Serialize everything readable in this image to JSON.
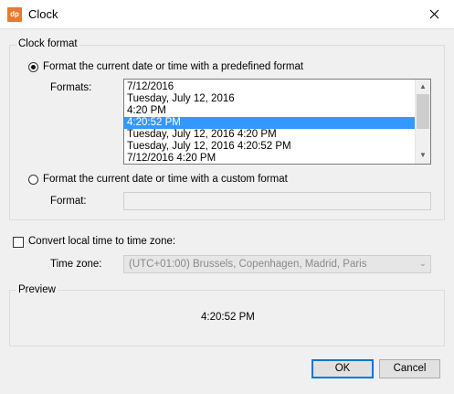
{
  "window": {
    "title": "Clock",
    "app_icon_text": "dp"
  },
  "clock_format": {
    "group_label": "Clock format",
    "predefined_radio_label": "Format the current date or time with a predefined format",
    "formats_label": "Formats:",
    "formats": [
      "7/12/2016",
      "Tuesday, July 12, 2016",
      "4:20 PM",
      "4:20:52 PM",
      "Tuesday, July 12, 2016 4:20 PM",
      "Tuesday, July 12, 2016 4:20:52 PM",
      "7/12/2016 4:20 PM"
    ],
    "selected_format": "4:20:52 PM",
    "custom_radio_label": "Format the current date or time with a custom format",
    "custom_format_label": "Format:",
    "custom_format_value": ""
  },
  "time_zone": {
    "checkbox_label": "Convert local time to time zone:",
    "label": "Time zone:",
    "selected": "(UTC+01:00) Brussels, Copenhagen, Madrid, Paris"
  },
  "preview": {
    "label": "Preview",
    "value": "4:20:52 PM"
  },
  "buttons": {
    "ok": "OK",
    "cancel": "Cancel"
  },
  "colors": {
    "selection": "#3399ff",
    "default_button_border": "#0078d7",
    "app_icon": "#e8792f"
  }
}
